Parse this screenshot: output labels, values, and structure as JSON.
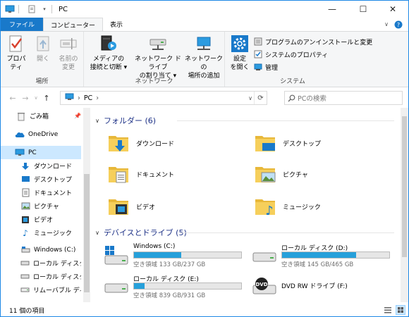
{
  "window": {
    "title": "PC",
    "minimize": "—",
    "maximize": "☐",
    "close": "✕"
  },
  "tabs": [
    {
      "label": "ファイル"
    },
    {
      "label": "コンピューター"
    },
    {
      "label": "表示"
    }
  ],
  "ribbon": {
    "groups": [
      {
        "label": "場所",
        "buttons": [
          {
            "label1": "プロパティ",
            "label2": "",
            "icon": "properties-checkmark-icon"
          },
          {
            "label1": "開く",
            "label2": "",
            "icon": "open-icon"
          },
          {
            "label1": "名前の",
            "label2": "変更",
            "icon": "rename-icon"
          }
        ]
      },
      {
        "label": "ネットワーク",
        "buttons": [
          {
            "label1": "メディアの",
            "label2": "接続と切断 ▾",
            "icon": "media-server-icon"
          },
          {
            "label1": "ネットワーク ドライブ",
            "label2": "の割り当て ▾",
            "icon": "map-network-drive-icon"
          },
          {
            "label1": "ネットワークの",
            "label2": "場所の追加",
            "icon": "network-location-icon"
          }
        ]
      },
      {
        "label": "システム",
        "buttons": [
          {
            "label1": "設定",
            "label2": "を開く",
            "icon": "settings-gear-icon"
          }
        ],
        "small": [
          {
            "label": "プログラムのアンインストールと変更",
            "icon": "programs-icon"
          },
          {
            "label": "システムのプロパティ",
            "icon": "system-properties-icon"
          },
          {
            "label": "管理",
            "icon": "manage-icon"
          }
        ]
      }
    ]
  },
  "address": {
    "crumb": "PC",
    "separator": "›",
    "search_placeholder": "PCの検索"
  },
  "nav": {
    "items": [
      {
        "label": "ごみ箱",
        "icon": "recycle-bin-icon"
      },
      {
        "label": "OneDrive",
        "icon": "onedrive-cloud-icon"
      },
      {
        "label": "PC",
        "icon": "pc-monitor-icon"
      },
      {
        "label": "ダウンロード",
        "icon": "download-arrow-icon"
      },
      {
        "label": "デスクトップ",
        "icon": "desktop-icon"
      },
      {
        "label": "ドキュメント",
        "icon": "documents-icon"
      },
      {
        "label": "ピクチャ",
        "icon": "pictures-icon"
      },
      {
        "label": "ビデオ",
        "icon": "videos-icon"
      },
      {
        "label": "ミュージック",
        "icon": "music-icon"
      },
      {
        "label": "Windows (C:)",
        "icon": "windows-drive-icon"
      },
      {
        "label": "ローカル ディスク (D:)",
        "icon": "local-disk-icon"
      },
      {
        "label": "ローカル ディスク (E:)",
        "icon": "local-disk-icon"
      },
      {
        "label": "リムーバブル ディスク (F:)",
        "icon": "removable-disk-icon"
      }
    ]
  },
  "folders_section": {
    "title": "フォルダー (6)",
    "items": [
      {
        "label": "ダウンロード",
        "icon": "downloads-folder-icon"
      },
      {
        "label": "デスクトップ",
        "icon": "desktop-folder-icon"
      },
      {
        "label": "ドキュメント",
        "icon": "documents-folder-icon"
      },
      {
        "label": "ピクチャ",
        "icon": "pictures-folder-icon"
      },
      {
        "label": "ビデオ",
        "icon": "videos-folder-icon"
      },
      {
        "label": "ミュージック",
        "icon": "music-folder-icon"
      }
    ]
  },
  "drives_section": {
    "title": "デバイスとドライブ (5)",
    "items": [
      {
        "name": "Windows (C:)",
        "free": "空き領域 133 GB/237 GB",
        "used_fraction": 0.44,
        "icon": "windows-drive-icon"
      },
      {
        "name": "ローカル ディスク (D:)",
        "free": "空き領域 145 GB/465 GB",
        "used_fraction": 0.69,
        "icon": "local-disk-icon"
      },
      {
        "name": "ローカル ディスク (E:)",
        "free": "空き領域 839 GB/931 GB",
        "used_fraction": 0.1,
        "icon": "local-disk-icon"
      },
      {
        "name": "DVD RW ドライブ (F:)",
        "free": "",
        "used_fraction": null,
        "icon": "dvd-drive-icon"
      }
    ]
  },
  "status": {
    "count": "11 個の項目"
  },
  "colors": {
    "accent": "#1979ca",
    "drive_fill": "#26a0da",
    "selection": "#cce8ff",
    "section_title": "#1e3287"
  }
}
